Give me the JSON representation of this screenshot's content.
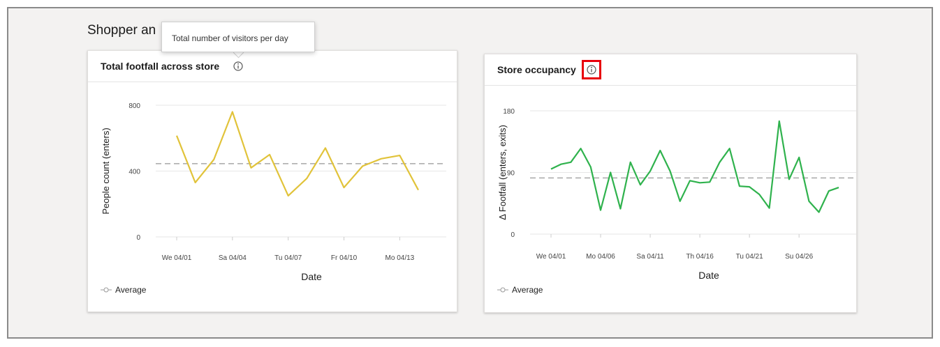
{
  "section": {
    "title": "Shopper an"
  },
  "tooltip": {
    "text": "Total number of visitors per day"
  },
  "charts": [
    {
      "title": "Total footfall across store",
      "legend": "Average",
      "chart_data": {
        "type": "line",
        "xlabel": "Date",
        "ylabel": "People count (enters)",
        "ylim": [
          0,
          800
        ],
        "yticks": [
          0,
          400,
          800
        ],
        "tick_labels": [
          "We 04/01",
          "Sa 04/04",
          "Tu 04/07",
          "Fr 04/10",
          "Mo 04/13"
        ],
        "x": [
          "04/01",
          "04/02",
          "04/03",
          "04/04",
          "04/05",
          "04/06",
          "04/07",
          "04/08",
          "04/09",
          "04/10",
          "04/11",
          "04/12",
          "04/13",
          "04/14"
        ],
        "values": [
          615,
          330,
          470,
          760,
          420,
          500,
          250,
          355,
          540,
          300,
          430,
          475,
          495,
          285
        ],
        "average": 445,
        "color": "#e1c33a",
        "grid": true
      }
    },
    {
      "title": "Store occupancy",
      "legend": "Average",
      "chart_data": {
        "type": "line",
        "xlabel": "Date",
        "ylabel": "Δ Footfall (enters, exits)",
        "ylim": [
          0,
          180
        ],
        "yticks": [
          0,
          90,
          180
        ],
        "tick_labels": [
          "We 04/01",
          "Mo 04/06",
          "Sa 04/11",
          "Th 04/16",
          "Tu 04/21",
          "Su 04/26"
        ],
        "x": [
          "04/01",
          "04/02",
          "04/03",
          "04/04",
          "04/05",
          "04/06",
          "04/07",
          "04/08",
          "04/09",
          "04/10",
          "04/11",
          "04/12",
          "04/13",
          "04/14",
          "04/15",
          "04/16",
          "04/17",
          "04/18",
          "04/19",
          "04/20",
          "04/21",
          "04/22",
          "04/23",
          "04/24",
          "04/25",
          "04/26",
          "04/27",
          "04/28",
          "04/29"
        ],
        "values": [
          95,
          102,
          105,
          125,
          98,
          35,
          90,
          37,
          105,
          72,
          92,
          122,
          92,
          48,
          78,
          75,
          76,
          105,
          125,
          70,
          69,
          58,
          38,
          165,
          80,
          112,
          48,
          32,
          63,
          68
        ],
        "average": 82,
        "color": "#2fb24d",
        "grid": true
      }
    }
  ]
}
